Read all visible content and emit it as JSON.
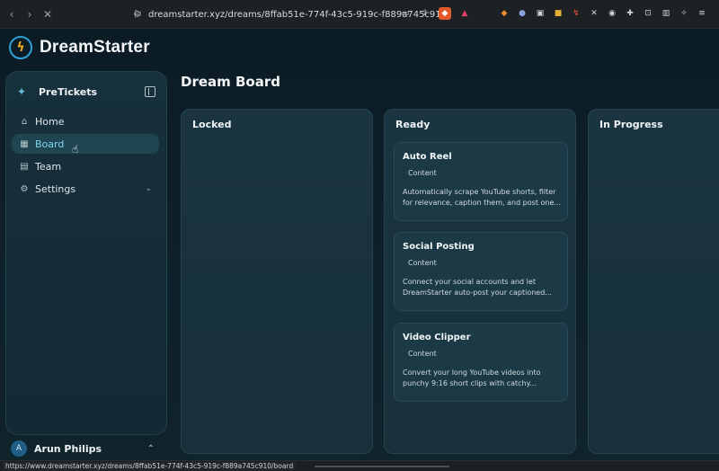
{
  "browser": {
    "url": "dreamstarter.xyz/dreams/8ffab51e-774f-43c5-919c-f889a745c91..."
  },
  "app": {
    "brand": "DreamStarter",
    "workspace": "PreTickets",
    "nav": [
      {
        "label": "Home",
        "icon": "home-icon"
      },
      {
        "label": "Board",
        "icon": "board-grid-icon"
      },
      {
        "label": "Team",
        "icon": "team-icon"
      },
      {
        "label": "Settings",
        "icon": "settings-icon"
      }
    ],
    "user": {
      "initial": "A",
      "name": "Arun Philips"
    },
    "page_title": "Dream Board",
    "columns": [
      {
        "title": "Locked",
        "cards": []
      },
      {
        "title": "Ready",
        "cards": [
          {
            "title": "Auto Reel",
            "tag": "Content",
            "description": "Automatically scrape YouTube shorts, filter for relevance, caption them, and post one..."
          },
          {
            "title": "Social Posting",
            "tag": "Content",
            "description": "Connect your social accounts and let DreamStarter auto-post your captioned..."
          },
          {
            "title": "Video Clipper",
            "tag": "Content",
            "description": "Convert your long YouTube videos into punchy 9:16 short clips with catchy..."
          }
        ]
      },
      {
        "title": "In Progress",
        "cards": []
      }
    ]
  },
  "status_bar": {
    "link": "https://www.dreamstarter.xyz/dreams/8ffab51e-774f-43c5-919c-f889a745c910/board"
  },
  "colors": {
    "accent": "#7fd6ee",
    "background": "#0c1c25",
    "logo_bolt": "#f2a81c"
  }
}
